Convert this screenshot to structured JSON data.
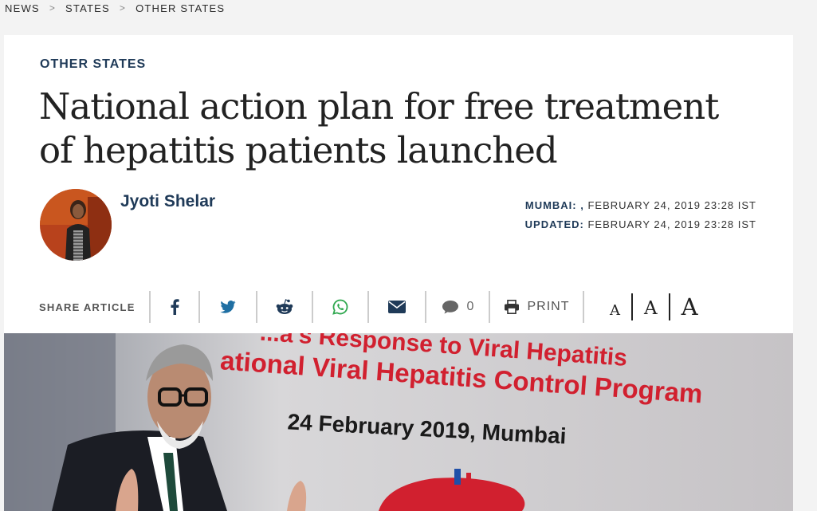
{
  "breadcrumb": {
    "items": [
      "NEWS",
      "STATES",
      "OTHER STATES"
    ],
    "separator": ">"
  },
  "article": {
    "kicker": "OTHER STATES",
    "headline": "National action plan for free treatment of hepatitis patients launched",
    "author": "Jyoti Shelar",
    "dateline": {
      "place_label": "MUMBAI: ,",
      "published": "FEBRUARY 24, 2019 23:28 IST",
      "updated_label": "UPDATED:",
      "updated": "FEBRUARY 24, 2019 23:28 IST"
    }
  },
  "share": {
    "label": "SHARE ARTICLE",
    "icons": [
      "facebook-icon",
      "twitter-icon",
      "reddit-icon",
      "whatsapp-icon",
      "email-icon"
    ],
    "comment_count": "0",
    "print_label": "PRINT",
    "font_sizes": [
      "A",
      "A",
      "A"
    ]
  },
  "hero": {
    "banner_line1": "...a's Response to Viral Hepatitis",
    "banner_line2": "ational Viral Hepatitis Control Program",
    "banner_line3": "24 February 2019, Mumbai"
  },
  "colors": {
    "accent": "#1f3a58",
    "banner_red": "#d1202f",
    "page_bg": "#f3f3f3"
  }
}
